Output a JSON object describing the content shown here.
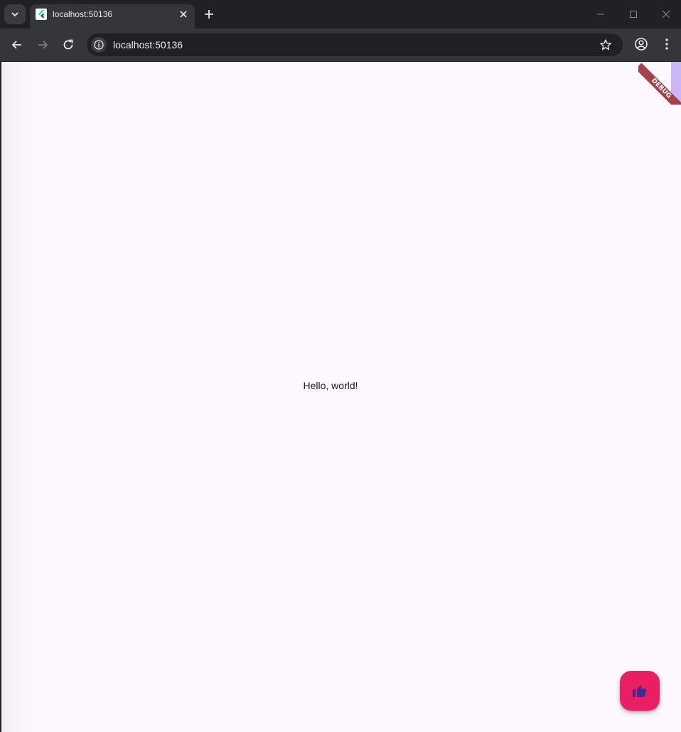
{
  "browser": {
    "tab": {
      "title": "localhost:50136"
    },
    "address_bar": {
      "url": "localhost:50136"
    }
  },
  "page": {
    "body_text": "Hello, world!",
    "debug_banner": "DEBUG",
    "fab": {
      "icon": "thumb-up-icon",
      "color": "#e91e63"
    },
    "background": "#fdf7fe"
  }
}
